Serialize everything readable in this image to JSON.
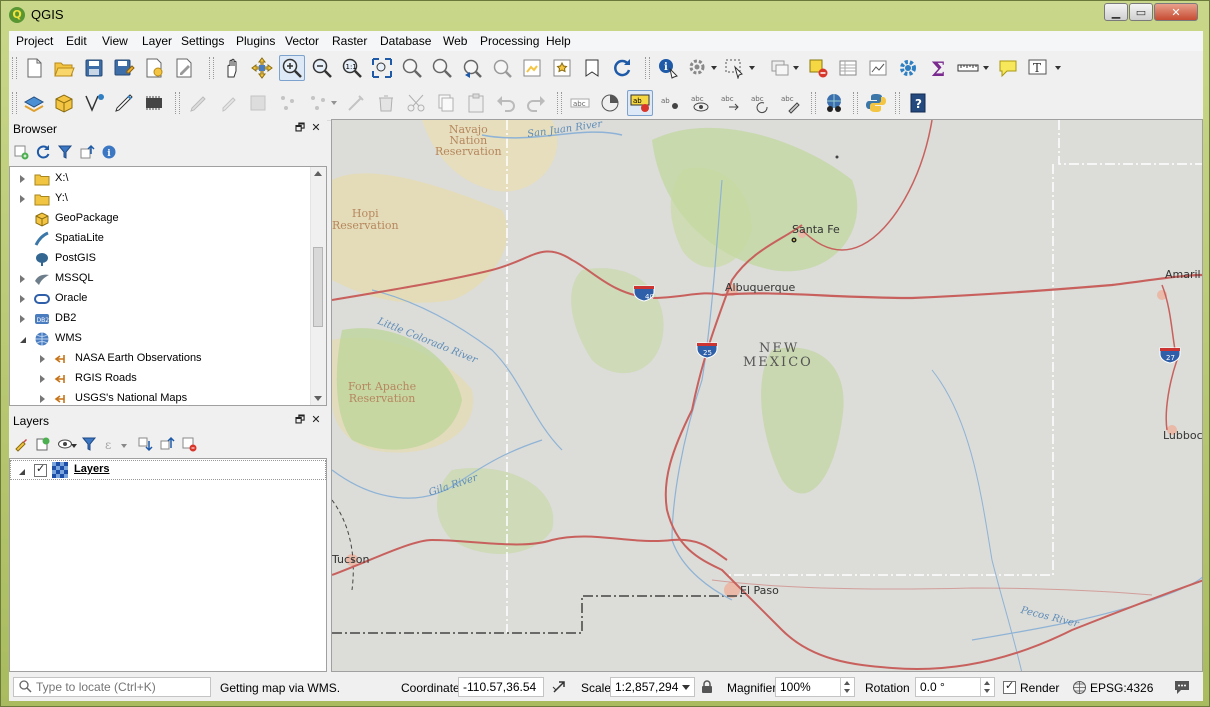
{
  "window": {
    "title": "QGIS"
  },
  "menu": [
    "Project",
    "Edit",
    "View",
    "Layer",
    "Settings",
    "Plugins",
    "Vector",
    "Raster",
    "Database",
    "Web",
    "Processing",
    "Help"
  ],
  "browser": {
    "title": "Browser",
    "items": [
      {
        "label": "X:\\",
        "icon": "folder-icon"
      },
      {
        "label": "Y:\\",
        "icon": "folder-icon"
      },
      {
        "label": "GeoPackage",
        "icon": "geopackage-icon"
      },
      {
        "label": "SpatiaLite",
        "icon": "spatialite-icon"
      },
      {
        "label": "PostGIS",
        "icon": "postgis-icon"
      },
      {
        "label": "MSSQL",
        "icon": "mssql-icon"
      },
      {
        "label": "Oracle",
        "icon": "oracle-icon"
      },
      {
        "label": "DB2",
        "icon": "db2-icon"
      },
      {
        "label": "WMS",
        "icon": "wms-icon"
      },
      {
        "label": "NASA Earth Observations",
        "icon": "wms-connection-icon"
      },
      {
        "label": "RGIS Roads",
        "icon": "wms-connection-icon"
      },
      {
        "label": "USGS's National Maps",
        "icon": "wms-connection-icon"
      }
    ]
  },
  "layers": {
    "title": "Layers",
    "items": [
      {
        "label": "Layers",
        "checked": true
      }
    ]
  },
  "map": {
    "labels": {
      "navajo": "Navajo\nNation\nReservation",
      "hopi": "Hopi\nReservation",
      "fortapache": "Fort Apache\nReservation",
      "santafe": "Santa Fe",
      "albuquerque": "Albuquerque",
      "nm1": "NEW",
      "nm2": "MEXICO",
      "elpaso": "El Paso",
      "tucson": "Tucson",
      "amarillo": "Amaril",
      "lubbock": "Lubboc",
      "sanjuan": "San Juan River",
      "littlecolorado": "Little Colorado River",
      "gila": "Gila River",
      "pecos": "Pecos River",
      "i40": "40",
      "i25": "25",
      "i27": "27"
    }
  },
  "status": {
    "locator_placeholder": "Type to locate (Ctrl+K)",
    "message": "Getting map via WMS.",
    "coordinate_label": "Coordinate",
    "coordinate_value": "-110.57,36.54",
    "scale_label": "Scale",
    "scale_value": "1:2,857,294",
    "magnifier_label": "Magnifier",
    "magnifier_value": "100%",
    "rotation_label": "Rotation",
    "rotation_value": "0.0 °",
    "render_label": "Render",
    "render_checked": true,
    "crs": "EPSG:4326"
  },
  "colors": {
    "road": "#c8615d",
    "river": "#7ca7cf",
    "green": "#b5cf8e",
    "tan": "#e9deb0"
  }
}
